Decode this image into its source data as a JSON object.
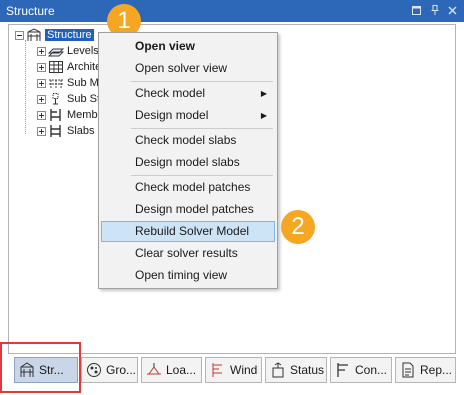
{
  "window": {
    "title": "Structure"
  },
  "tree": {
    "root": {
      "label": "Structure"
    },
    "children": [
      {
        "label": "Levels",
        "icon": "levels-icon"
      },
      {
        "label": "Architecture",
        "icon": "grid-icon"
      },
      {
        "label": "Sub Model",
        "icon": "sub-model-icon"
      },
      {
        "label": "Sub Structure",
        "icon": "sub-structure-icon"
      },
      {
        "label": "Members",
        "icon": "members-icon"
      },
      {
        "label": "Slabs",
        "icon": "slabs-icon"
      }
    ]
  },
  "context_menu": {
    "items": [
      {
        "label": "Open view",
        "bold": true
      },
      {
        "label": "Open solver view"
      },
      {
        "label": "Check model",
        "submenu": true
      },
      {
        "label": "Design model",
        "submenu": true
      },
      {
        "label": "Check model slabs"
      },
      {
        "label": "Design model slabs"
      },
      {
        "label": "Check model patches"
      },
      {
        "label": "Design model patches"
      },
      {
        "label": "Rebuild Solver Model",
        "highlighted": true
      },
      {
        "label": "Clear solver results"
      },
      {
        "label": "Open timing view"
      }
    ]
  },
  "badges": {
    "step1": "1",
    "step2": "2"
  },
  "bottom_tabs": [
    {
      "label": "Str...",
      "icon": "structure-icon",
      "active": true
    },
    {
      "label": "Gro...",
      "icon": "group-icon"
    },
    {
      "label": "Loa...",
      "icon": "loads-icon"
    },
    {
      "label": "Wind",
      "icon": "wind-icon"
    },
    {
      "label": "Status",
      "icon": "status-icon"
    },
    {
      "label": "Con...",
      "icon": "connections-icon"
    },
    {
      "label": "Rep...",
      "icon": "report-icon"
    }
  ],
  "colors": {
    "titlebar": "#2d68b8",
    "badge": "#f5a623",
    "menu_highlight": "#cde4f7",
    "selection": "#1e5fbf",
    "callout_border": "#e03a3a"
  }
}
